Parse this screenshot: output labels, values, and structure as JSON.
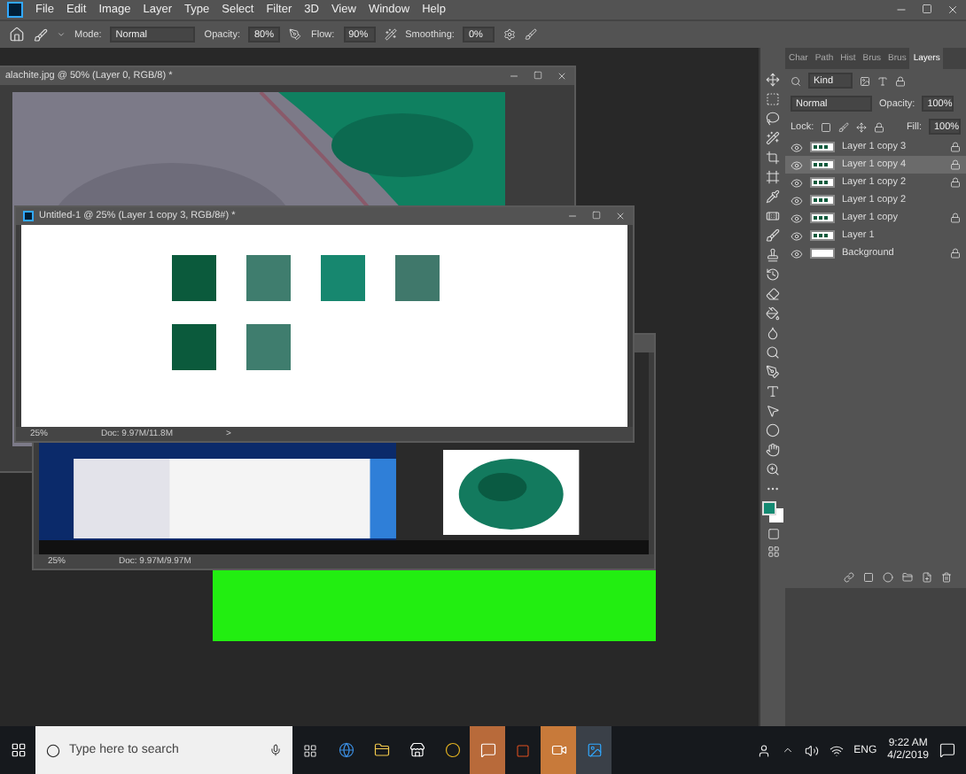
{
  "menu": [
    "File",
    "Edit",
    "Image",
    "Layer",
    "Type",
    "Select",
    "Filter",
    "3D",
    "View",
    "Window",
    "Help"
  ],
  "options_bar": {
    "mode_label": "Mode:",
    "mode": "Normal",
    "opacity_label": "Opacity:",
    "opacity": "80%",
    "flow_label": "Flow:",
    "flow": "90%",
    "smoothing_label": "Smoothing:",
    "smoothing": "0%"
  },
  "back_window": {
    "title": "alachite.jpg @ 50% (Layer 0, RGB/8) *"
  },
  "middle_window": {
    "zoom": "25%",
    "doc_size": "Doc: 9.97M/9.97M"
  },
  "front_window": {
    "title": "Untitled-1 @ 25% (Layer 1 copy 3, RGB/8#) *",
    "zoom": "25%",
    "doc_size": "Doc: 9.97M/11.8M",
    "arrow": ">",
    "swatches": [
      {
        "color": "#0b5a3c"
      },
      {
        "color": "#3f7d6e"
      },
      {
        "color": "#17876f"
      },
      {
        "color": "#40786b"
      },
      {
        "color": "#0b5a3c"
      },
      {
        "color": "#3f7d6e"
      }
    ]
  },
  "layers_panel": {
    "tabs": [
      {
        "label": "Char",
        "selected": false
      },
      {
        "label": "Path",
        "selected": false
      },
      {
        "label": "Hist",
        "selected": false
      },
      {
        "label": "Brus",
        "selected": false
      },
      {
        "label": "Brus",
        "selected": false
      },
      {
        "label": "Layers",
        "selected": true
      }
    ],
    "filter": "Kind",
    "blend_mode": "Normal",
    "opacity_label": "Opacity:",
    "opacity": "100%",
    "lock_label": "Lock:",
    "fill_label": "Fill:",
    "fill": "100%",
    "layers": [
      {
        "name": "Layer 1 copy 3",
        "selected": false,
        "locked": true
      },
      {
        "name": "Layer 1 copy 4",
        "selected": true,
        "locked": true
      },
      {
        "name": "Layer 1 copy 2",
        "selected": false,
        "locked": true
      },
      {
        "name": "Layer 1 copy 2",
        "selected": false,
        "locked": false
      },
      {
        "name": "Layer 1 copy",
        "selected": false,
        "locked": true
      },
      {
        "name": "Layer 1",
        "selected": false,
        "locked": false
      },
      {
        "name": "Background",
        "selected": false,
        "locked": true
      }
    ]
  },
  "taskbar": {
    "search_placeholder": "Type here to search",
    "language": "ENG",
    "time": "9:22 AM",
    "date": "4/2/2019"
  }
}
